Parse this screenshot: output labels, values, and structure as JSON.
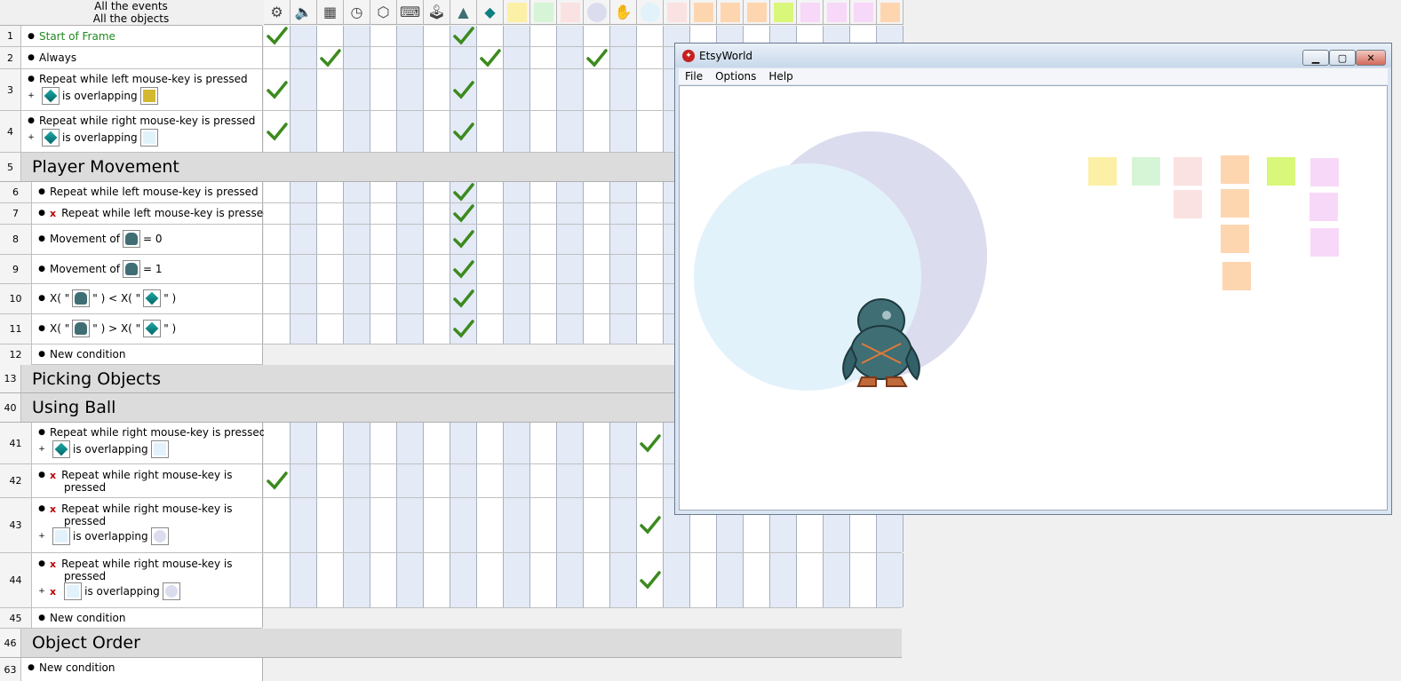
{
  "header": {
    "line1": "All the events",
    "line2": "All the objects",
    "columns": [
      {
        "icon": "gear-icon"
      },
      {
        "icon": "speaker-icon"
      },
      {
        "icon": "checker-flag-icon"
      },
      {
        "icon": "timer-icon"
      },
      {
        "icon": "cube-icon"
      },
      {
        "icon": "keyboard-icon"
      },
      {
        "icon": "joystick-icon"
      },
      {
        "icon": "player-bird-icon"
      },
      {
        "icon": "gem-icon"
      },
      {
        "icon": "swatch-yellow",
        "color": "#fbf0a6"
      },
      {
        "icon": "swatch-green",
        "color": "#d6f5d6"
      },
      {
        "icon": "swatch-pink",
        "color": "#fbe2e2"
      },
      {
        "icon": "swatch-lavender-ball",
        "color": "#dcdcef"
      },
      {
        "icon": "hand-cursor-icon"
      },
      {
        "icon": "swatch-lightblue-ball",
        "color": "#e2f2fb"
      },
      {
        "icon": "swatch-pink2",
        "color": "#fbe2e2"
      },
      {
        "icon": "swatch-orange",
        "color": "#fdd6b0"
      },
      {
        "icon": "swatch-orange2",
        "color": "#fdd6b0"
      },
      {
        "icon": "swatch-orange3",
        "color": "#fdd6b0"
      },
      {
        "icon": "swatch-lime",
        "color": "#d9f77a"
      },
      {
        "icon": "swatch-violet",
        "color": "#f8d8f8"
      },
      {
        "icon": "swatch-violet2",
        "color": "#f8d8f8"
      },
      {
        "icon": "swatch-violet3",
        "color": "#f8d8f8"
      },
      {
        "icon": "swatch-orange4",
        "color": "#fdd6b0"
      }
    ]
  },
  "rows": {
    "r1": {
      "num": "1",
      "text": "Start of Frame"
    },
    "r2": {
      "num": "2",
      "text": "Always"
    },
    "r3": {
      "num": "3",
      "line1": "Repeat while left mouse-key is pressed",
      "line2": "is overlapping"
    },
    "r4": {
      "num": "4",
      "line1": "Repeat while right mouse-key is pressed",
      "line2": "is overlapping"
    },
    "g5": {
      "num": "5",
      "title": "Player Movement"
    },
    "r6": {
      "num": "6",
      "text": "Repeat while left mouse-key is pressed"
    },
    "r7": {
      "num": "7",
      "mark": "x",
      "text": "Repeat while left mouse-key is pressed"
    },
    "r8": {
      "num": "8",
      "pre": "Movement of",
      "post": "= 0"
    },
    "r9": {
      "num": "9",
      "pre": "Movement of",
      "post": "= 1"
    },
    "r10": {
      "num": "10",
      "a": "X( \"",
      "b": "\" ) < X( \"",
      "c": "\" )"
    },
    "r11": {
      "num": "11",
      "a": "X( \"",
      "b": "\" ) > X( \"",
      "c": "\" )"
    },
    "r12": {
      "num": "12",
      "text": "New condition"
    },
    "g13": {
      "num": "13",
      "title": "Picking Objects"
    },
    "g40": {
      "num": "40",
      "title": "Using Ball"
    },
    "r41": {
      "num": "41",
      "line1": "Repeat while right mouse-key is pressed",
      "line2": "is overlapping"
    },
    "r42": {
      "num": "42",
      "mark": "x",
      "line1": "Repeat while right mouse-key is",
      "line1b": "pressed"
    },
    "r43": {
      "num": "43",
      "mark": "x",
      "line1": "Repeat while right mouse-key is",
      "line1b": "pressed",
      "line2": "is overlapping"
    },
    "r44": {
      "num": "44",
      "mark": "x",
      "line1": "Repeat while right mouse-key is",
      "line1b": "pressed",
      "mark2": "x",
      "line2": "is overlapping"
    },
    "r45": {
      "num": "45",
      "text": "New condition"
    },
    "g46": {
      "num": "46",
      "title": "Object Order"
    },
    "r63": {
      "num": "63",
      "text": "New condition"
    }
  },
  "window": {
    "title": "EtsyWorld",
    "menu": [
      "File",
      "Options",
      "Help"
    ],
    "buttons": {
      "minimize": "▁",
      "maximize": "▢",
      "close": "✕"
    }
  },
  "colors": {
    "check": "#3c8a1e",
    "accent_green": "#208a20",
    "x_mark": "#c00000"
  }
}
